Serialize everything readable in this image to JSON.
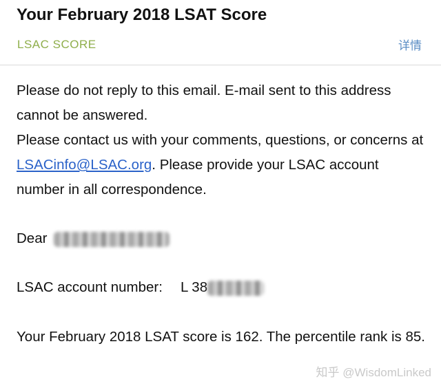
{
  "header": {
    "subject": "Your February 2018 LSAT Score",
    "sender": "LSAC SCORE",
    "details_label": "详情"
  },
  "body": {
    "intro_line1": "Please do not reply to this email.  E-mail sent to this address cannot be answered.",
    "intro_line2_before": "Please contact us with your comments, questions, or concerns at ",
    "email_link": "LSACinfo@LSAC.org",
    "intro_line2_after": ".  Please provide your LSAC account number in all correspondence.",
    "dear_label": "Dear",
    "account_label": "LSAC account number:",
    "account_prefix": "L 38",
    "score_text": "Your February 2018 LSAT score is 162.  The percentile rank is 85."
  },
  "watermark": "知乎 @WisdomLinked"
}
